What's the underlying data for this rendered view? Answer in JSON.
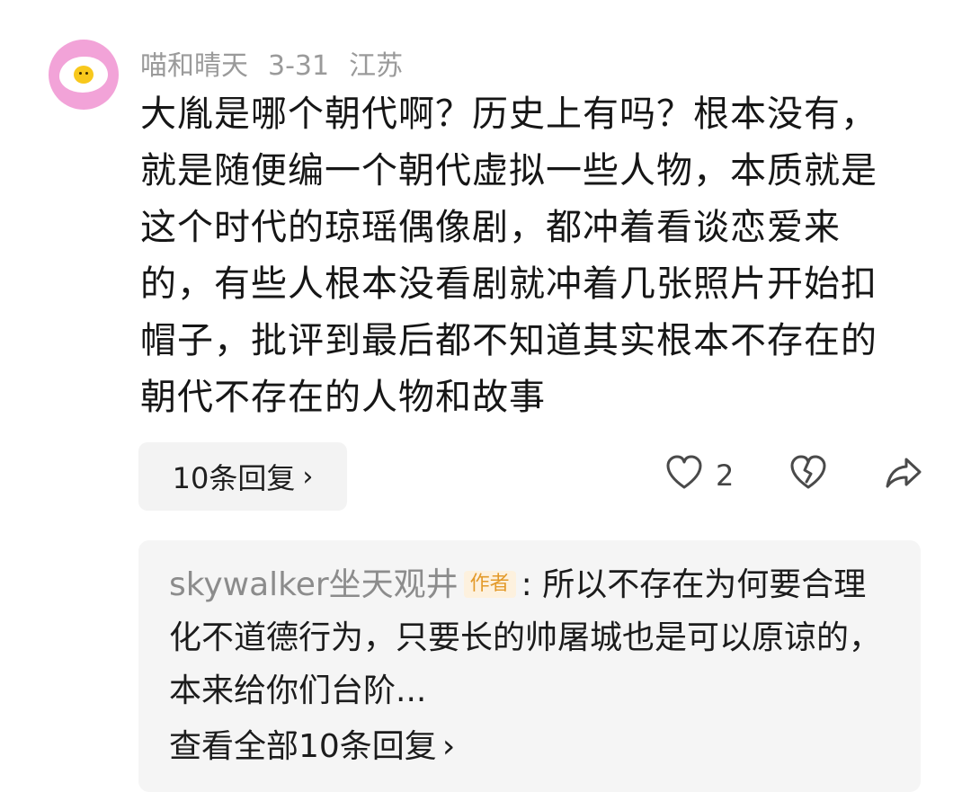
{
  "comment": {
    "username": "喵和晴天",
    "date": "3-31",
    "location": "江苏",
    "text": "大胤是哪个朝代啊？历史上有吗？根本没有，就是随便编一个朝代虚拟一些人物，本质就是这个时代的琼瑶偶像剧，都冲着看谈恋爱来的，有些人根本没看剧就冲着几张照片开始扣帽子，批评到最后都不知道其实根本不存在的朝代不存在的人物和故事",
    "reply_button_label": "10条回复",
    "like_count": "2",
    "icons": {
      "avatar": "fried-egg-avatar",
      "like": "heart-outline-icon",
      "dislike": "broken-heart-icon",
      "share": "share-arrow-icon",
      "chevron": "chevron-right-icon"
    }
  },
  "reply_preview": {
    "username": "skywalker坐天观井",
    "badge": "作者",
    "separator": ":",
    "text": "所以不存在为何要合理化不道德行为，只要长的帅屠城也是可以原谅的，本来给你们台阶...",
    "view_all_label": "查看全部10条回复"
  },
  "colors": {
    "avatar_bg": "#f2a3d8",
    "meta_text": "#9a9a9a",
    "reply_bg": "#f5f5f5",
    "badge_bg": "#fdf1de",
    "badge_text": "#e39a2a"
  }
}
